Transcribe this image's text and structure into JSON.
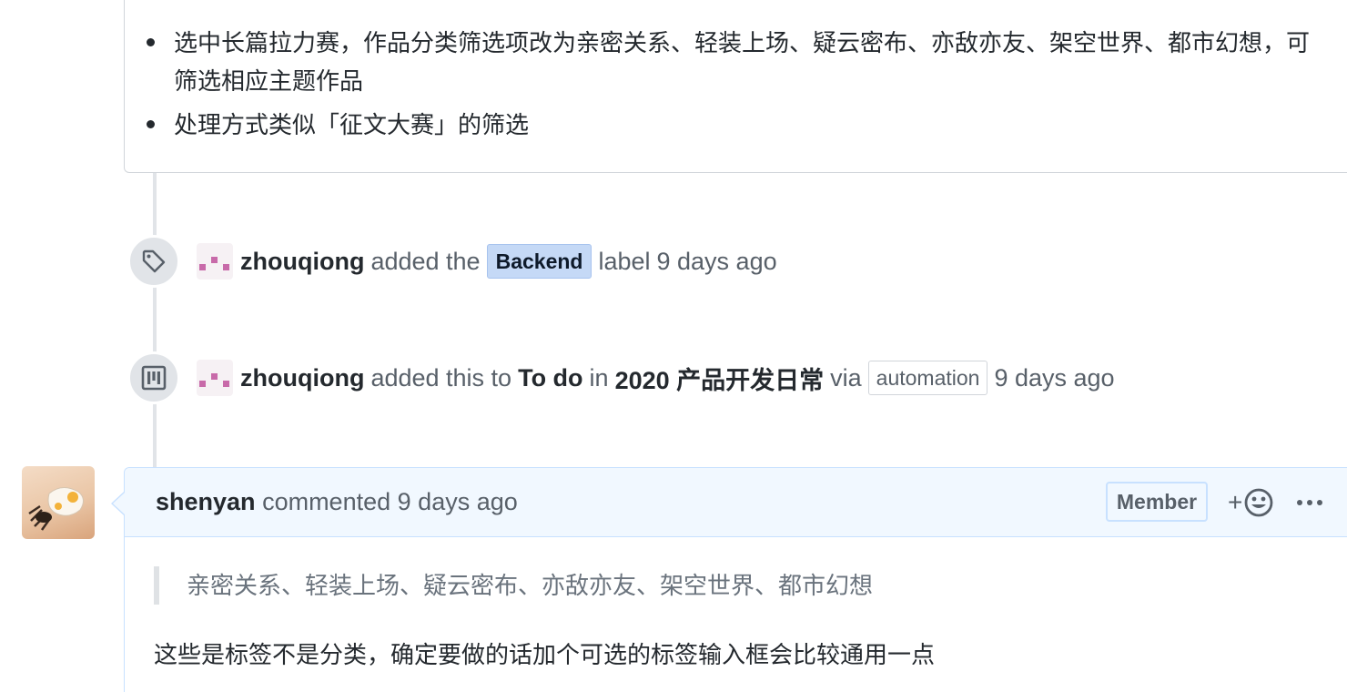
{
  "top_comment": {
    "items": [
      "选中长篇拉力赛，作品分类筛选项改为亲密关系、轻装上场、疑云密布、亦敌亦友、架空世界、都市幻想，可筛选相应主题作品",
      "处理方式类似「征文大赛」的筛选"
    ]
  },
  "events": [
    {
      "icon": "tag-icon",
      "author": "zhouqiong",
      "pre": "added the",
      "label": "Backend",
      "post": "label",
      "time": "9 days ago"
    },
    {
      "icon": "project-icon",
      "author": "zhouqiong",
      "pre": "added this to",
      "column": "To do",
      "in": "in",
      "project": "2020 产品开发日常",
      "via": "via",
      "via_badge": "automation",
      "time": "9 days ago"
    }
  ],
  "comment": {
    "author": "shenyan",
    "action": "commented",
    "time": "9 days ago",
    "role": "Member",
    "react_plus": "+",
    "quote": "亲密关系、轻装上场、疑云密布、亦敌亦友、架空世界、都市幻想",
    "body": "这些是标签不是分类，确定要做的话加个可选的标签输入框会比较通用一点"
  },
  "colors": {
    "label_bg": "#c5d9f6",
    "comment_header_bg": "#f1f8ff",
    "comment_border": "#c8e1ff",
    "timeline": "#e1e4e8"
  }
}
